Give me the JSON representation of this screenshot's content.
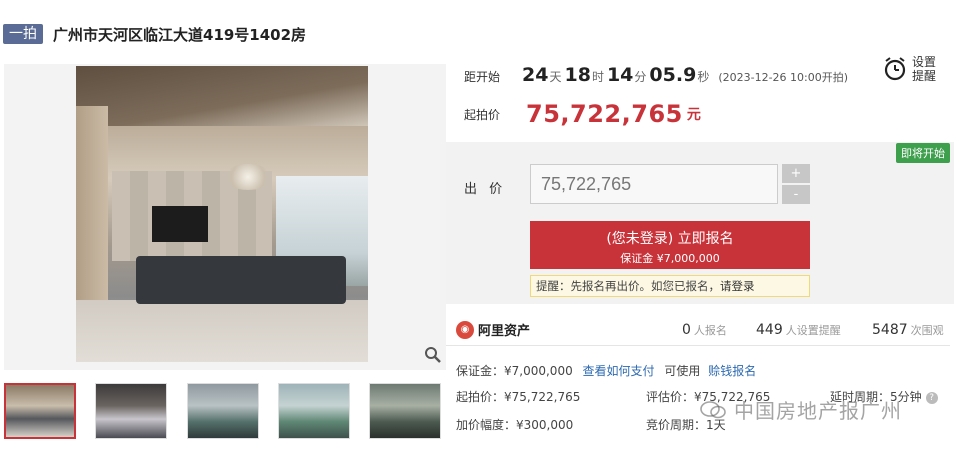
{
  "header": {
    "tag": "一拍",
    "title": "广州市天河区临江大道419号1402房"
  },
  "countdown": {
    "label": "距开始",
    "days": "24",
    "days_unit": "天",
    "hours": "18",
    "hours_unit": "时",
    "minutes": "14",
    "minutes_unit": "分",
    "seconds": "05.9",
    "seconds_unit": "秒",
    "start_time": "(2023-12-26 10:00开拍)"
  },
  "reminder": {
    "line1": "设置",
    "line2": "提醒",
    "icon": "alarm-clock-icon"
  },
  "starting_price": {
    "label": "起拍价",
    "value": "75,722,765",
    "unit": "元"
  },
  "bid": {
    "status_badge": "即将开始",
    "label": "出 价",
    "input_value": "75,722,765",
    "increment_label": "+",
    "decrement_label": "-",
    "signup_line1": "(您未登录) 立即报名",
    "signup_line2": "保证金 ¥7,000,000",
    "tip_prefix": "提醒：先报名再出价。如您已报名，",
    "tip_link": "请登录"
  },
  "stats": {
    "platform_name": "阿里资产",
    "signups_count": "0",
    "signups_label": "人报名",
    "reminders_count": "449",
    "reminders_label": "人设置提醒",
    "views_count": "5487",
    "views_label": "次围观"
  },
  "details": {
    "deposit": "保证金：¥7,000,000",
    "how_to_pay": "查看如何支付",
    "available": "可使用",
    "credit_signup": "赊钱报名",
    "start_price": "起拍价：¥75,722,765",
    "appraisal": "评估价：¥75,722,765",
    "extension": "延时周期：5分钟",
    "increment": "加价幅度：¥300,000",
    "bidding_cycle": "竞价周期：1天"
  },
  "watermark": {
    "text": "中国房地产报广州"
  },
  "colors": {
    "accent_red": "#c8333a",
    "tag_blue": "#5a6b95",
    "badge_green": "#3e9f4d",
    "link_blue": "#2d6ab1"
  }
}
